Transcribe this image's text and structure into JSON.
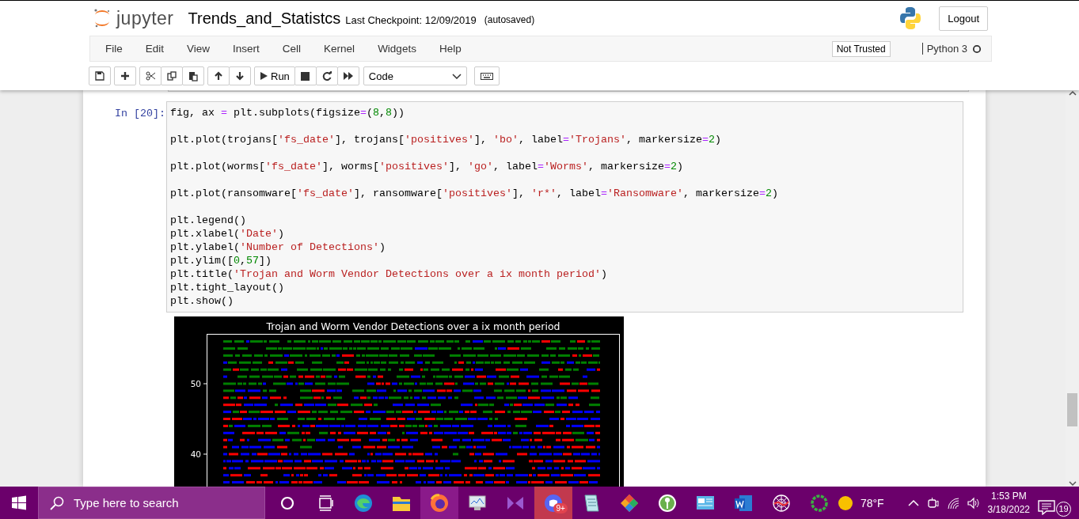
{
  "header": {
    "logo_text": "jupyter",
    "notebook_name": "Trends_and_Statistcs",
    "checkpoint": "Last Checkpoint: 12/09/2019",
    "autosave": "(autosaved)",
    "logout": "Logout"
  },
  "menu": [
    "File",
    "Edit",
    "View",
    "Insert",
    "Cell",
    "Kernel",
    "Widgets",
    "Help"
  ],
  "trust": "Not Trusted",
  "kernel": "Python 3",
  "toolbar": {
    "run_label": "Run",
    "cell_type": "Code"
  },
  "cell": {
    "prompt": "In [20]:",
    "blocks": [
      [
        "fig, ax = plt.subplots(figsize=(8,8))"
      ],
      [
        "plt.plot(trojans['fs_date'], trojans['positives'], 'bo', label='Trojans', markersize=2)"
      ],
      [
        "plt.plot(worms['fs_date'], worms['positives'], 'go', label='Worms', markersize=2)"
      ],
      [
        "plt.plot(ransomware['fs_date'], ransomware['positives'], 'r*', label='Ransomware', markersize=2)"
      ],
      [
        "plt.legend()",
        "plt.xlabel('Date')",
        "plt.ylabel('Number of Detections')",
        "plt.ylim([0,57])",
        "plt.title('Trojan and Worm Vendor Detections over a ix month period')",
        "plt.tight_layout()",
        "plt.show()"
      ]
    ]
  },
  "plot": {
    "title": "Trojan and Worm Vendor Detections over a ix month period",
    "yticks": [
      "50",
      "40"
    ]
  },
  "taskbar": {
    "search_placeholder": "Type here to search",
    "app_badge": "9+",
    "weather": "78°F",
    "time": "1:53 PM",
    "date": "3/18/2022",
    "notifications": "19"
  }
}
